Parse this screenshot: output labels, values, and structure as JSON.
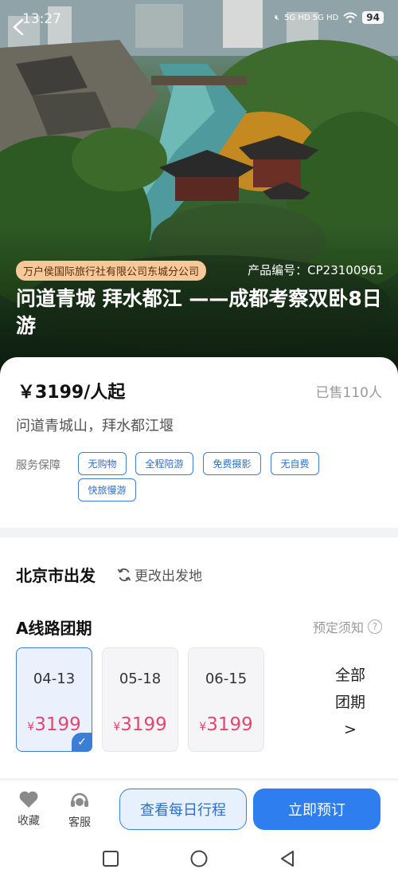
{
  "status_bar": {
    "time": "13:27",
    "network": "5G HD 5G HD",
    "battery": "94"
  },
  "hero": {
    "agency": "万户侯国际旅行社有限公司东城分公司",
    "product_code": "产品编号：CP23100961",
    "title": "问道青城 拜水都江 ——成都考察双卧8日游"
  },
  "price_card": {
    "price": "￥3199/人起",
    "sold": "已售110人",
    "subtitle": "问道青城山，拜水都江堰",
    "service_label": "服务保障",
    "tags": [
      "无购物",
      "全程陪游",
      "免费摄影",
      "无自费",
      "快旅慢游"
    ]
  },
  "departure": {
    "city": "北京市出发",
    "change": "更改出发地",
    "route": "A线路团期",
    "notice": "预定须知",
    "dates": [
      {
        "date": "04-13",
        "price": "3199",
        "currency": "¥",
        "selected": true
      },
      {
        "date": "05-18",
        "price": "3199",
        "currency": "¥",
        "selected": false
      },
      {
        "date": "06-15",
        "price": "3199",
        "currency": "¥",
        "selected": false
      }
    ],
    "all_dates": [
      "全部",
      "团期",
      ">"
    ]
  },
  "bottom_bar": {
    "favorite": "收藏",
    "service": "客服",
    "view_plan": "查看每日行程",
    "book": "立即预订"
  },
  "colors": {
    "accent": "#2f7ef0",
    "price_red": "#e3476e",
    "agency_badge": "#f6c89a"
  }
}
